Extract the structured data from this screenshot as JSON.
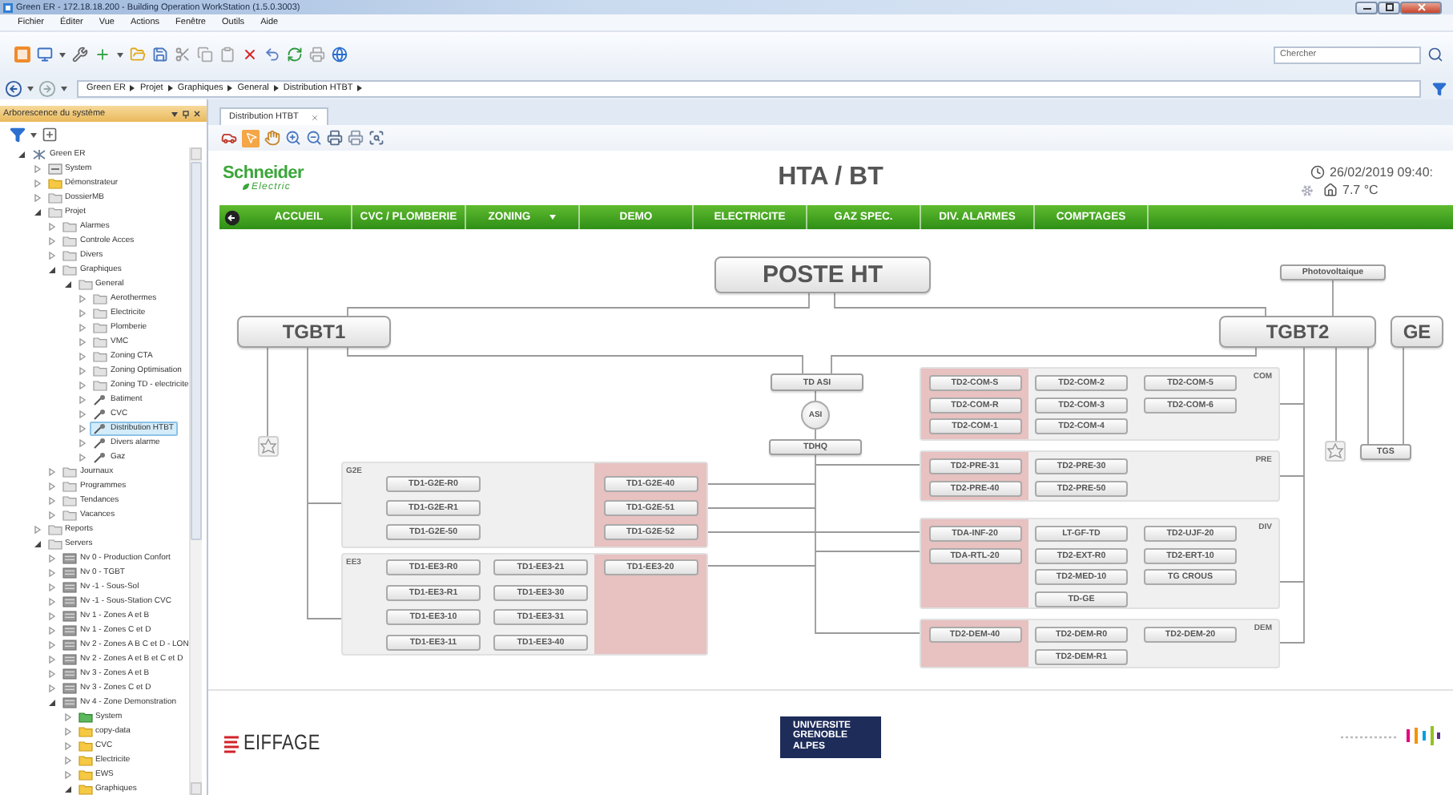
{
  "window": {
    "title": "Green ER - 172.18.18.200 - Building Operation WorkStation (1.5.0.3003)"
  },
  "menu": [
    "Fichier",
    "Éditer",
    "Vue",
    "Actions",
    "Fenêtre",
    "Outils",
    "Aide"
  ],
  "search": {
    "placeholder": "Chercher"
  },
  "breadcrumb": [
    "Green ER",
    "Projet",
    "Graphiques",
    "General",
    "Distribution HTBT"
  ],
  "tree_panel": {
    "title": "Arborescence du système",
    "items": [
      {
        "label": "Green ER",
        "kind": "network",
        "expanded": true,
        "selected": false,
        "children": [
          {
            "label": "System",
            "kind": "system",
            "expanded": false,
            "selected": false
          },
          {
            "label": "Démonstrateur",
            "kind": "folder_yellow",
            "expanded": false,
            "selected": false
          },
          {
            "label": "DossierMB",
            "kind": "folder",
            "expanded": false,
            "selected": false
          },
          {
            "label": "Projet",
            "kind": "folder",
            "expanded": true,
            "selected": false,
            "children": [
              {
                "label": "Alarmes",
                "kind": "folder",
                "expanded": false,
                "selected": false
              },
              {
                "label": "Controle Acces",
                "kind": "folder",
                "expanded": false,
                "selected": false
              },
              {
                "label": "Divers",
                "kind": "folder",
                "expanded": false,
                "selected": false
              },
              {
                "label": "Graphiques",
                "kind": "folder",
                "expanded": true,
                "selected": false,
                "children": [
                  {
                    "label": "General",
                    "kind": "folder",
                    "expanded": true,
                    "selected": false,
                    "children": [
                      {
                        "label": "Aerothermes",
                        "kind": "folder",
                        "expanded": false,
                        "selected": false
                      },
                      {
                        "label": "Electricite",
                        "kind": "folder",
                        "expanded": false,
                        "selected": false
                      },
                      {
                        "label": "Plomberie",
                        "kind": "folder",
                        "expanded": false,
                        "selected": false
                      },
                      {
                        "label": "VMC",
                        "kind": "folder",
                        "expanded": false,
                        "selected": false
                      },
                      {
                        "label": "Zoning CTA",
                        "kind": "folder",
                        "expanded": false,
                        "selected": false
                      },
                      {
                        "label": "Zoning Optimisation",
                        "kind": "folder",
                        "expanded": false,
                        "selected": false
                      },
                      {
                        "label": "Zoning TD - electricite",
                        "kind": "folder",
                        "expanded": false,
                        "selected": false
                      },
                      {
                        "label": "Batiment",
                        "kind": "graphic",
                        "expanded": false,
                        "selected": false
                      },
                      {
                        "label": "CVC",
                        "kind": "graphic",
                        "expanded": false,
                        "selected": false
                      },
                      {
                        "label": "Distribution HTBT",
                        "kind": "graphic",
                        "expanded": false,
                        "selected": true
                      },
                      {
                        "label": "Divers alarme",
                        "kind": "graphic",
                        "expanded": false,
                        "selected": false
                      },
                      {
                        "label": "Gaz",
                        "kind": "graphic",
                        "expanded": false,
                        "selected": false
                      }
                    ]
                  }
                ]
              },
              {
                "label": "Journaux",
                "kind": "folder",
                "expanded": false,
                "selected": false
              },
              {
                "label": "Programmes",
                "kind": "folder",
                "expanded": false,
                "selected": false
              },
              {
                "label": "Tendances",
                "kind": "folder",
                "expanded": false,
                "selected": false
              },
              {
                "label": "Vacances",
                "kind": "folder",
                "expanded": false,
                "selected": false
              }
            ]
          },
          {
            "label": "Reports",
            "kind": "folder",
            "expanded": false,
            "selected": false
          },
          {
            "label": "Servers",
            "kind": "folder",
            "expanded": true,
            "selected": false,
            "children": [
              {
                "label": "Nv 0 - Production Confort",
                "kind": "server",
                "expanded": false,
                "selected": false
              },
              {
                "label": "Nv 0 - TGBT",
                "kind": "server",
                "expanded": false,
                "selected": false
              },
              {
                "label": "Nv -1 - Sous-Sol",
                "kind": "server",
                "expanded": false,
                "selected": false
              },
              {
                "label": "Nv -1 - Sous-Station CVC",
                "kind": "server",
                "expanded": false,
                "selected": false
              },
              {
                "label": "Nv 1 - Zones A et B",
                "kind": "server",
                "expanded": false,
                "selected": false
              },
              {
                "label": "Nv 1 - Zones C et D",
                "kind": "server",
                "expanded": false,
                "selected": false
              },
              {
                "label": "Nv 2 - Zones A B C et D - LON",
                "kind": "server",
                "expanded": false,
                "selected": false
              },
              {
                "label": "Nv 2 - Zones A et B et C et D",
                "kind": "server",
                "expanded": false,
                "selected": false
              },
              {
                "label": "Nv 3 - Zones A et B",
                "kind": "server",
                "expanded": false,
                "selected": false
              },
              {
                "label": "Nv 3 - Zones C et D",
                "kind": "server",
                "expanded": false,
                "selected": false
              },
              {
                "label": "Nv 4 - Zone Demonstration",
                "kind": "server",
                "expanded": true,
                "selected": false,
                "children": [
                  {
                    "label": "System",
                    "kind": "folder_green",
                    "expanded": false,
                    "selected": false
                  },
                  {
                    "label": "copy-data",
                    "kind": "folder_yellow",
                    "expanded": false,
                    "selected": false
                  },
                  {
                    "label": "CVC",
                    "kind": "folder_yellow",
                    "expanded": false,
                    "selected": false
                  },
                  {
                    "label": "Electricite",
                    "kind": "folder_yellow",
                    "expanded": false,
                    "selected": false
                  },
                  {
                    "label": "EWS",
                    "kind": "folder_yellow",
                    "expanded": false,
                    "selected": false
                  },
                  {
                    "label": "Graphiques",
                    "kind": "folder_yellow",
                    "expanded": true,
                    "selected": false
                  }
                ]
              }
            ]
          }
        ]
      }
    ]
  },
  "document_tabs": [
    {
      "label": "Distribution HTBT",
      "selected": true
    }
  ],
  "graphic": {
    "brand": "Schneider",
    "brand_sub": "Electric",
    "title": "HTA / BT",
    "datetime": "26/02/2019 09:40:",
    "temperature": "7.7 °C",
    "nav": [
      {
        "label": "ACCUEIL",
        "dropdown": false
      },
      {
        "label": "CVC / PLOMBERIE",
        "dropdown": false
      },
      {
        "label": "ZONING",
        "dropdown": true
      },
      {
        "label": "DEMO",
        "dropdown": false
      },
      {
        "label": "ELECTRICITE",
        "dropdown": false
      },
      {
        "label": "GAZ SPEC.",
        "dropdown": false
      },
      {
        "label": "DIV. ALARMES",
        "dropdown": false
      },
      {
        "label": "COMPTAGES",
        "dropdown": false
      }
    ],
    "diagram": {
      "source": "POSTE HT",
      "photovoltaic": "Photovoltaique",
      "boards": [
        "TGBT1",
        "TGBT2"
      ],
      "generator": "GE",
      "ups_board": "TD ASI",
      "ups": "ASI",
      "hq_board": "TDHQ",
      "tgs": "TGS",
      "groups": [
        {
          "label": "G2E",
          "kind": "left",
          "alert": [
            "TD1-G2E-40",
            "TD1-G2E-51",
            "TD1-G2E-52"
          ],
          "columns": [
            [
              "TD1-G2E-R0",
              "TD1-G2E-R1",
              "TD1-G2E-50"
            ]
          ]
        },
        {
          "label": "EE3",
          "kind": "left",
          "alert": [
            "TD1-EE3-20"
          ],
          "columns": [
            [
              "TD1-EE3-R0",
              "TD1-EE3-R1",
              "TD1-EE3-10",
              "TD1-EE3-11"
            ],
            [
              "TD1-EE3-21",
              "TD1-EE3-30",
              "TD1-EE3-31",
              "TD1-EE3-40"
            ]
          ]
        },
        {
          "label": "COM",
          "kind": "right",
          "alert": [
            "TD2-COM-S",
            "TD2-COM-R",
            "TD2-COM-1"
          ],
          "columns": [
            [
              "TD2-COM-2",
              "TD2-COM-3",
              "TD2-COM-4"
            ],
            [
              "TD2-COM-5",
              "TD2-COM-6"
            ]
          ]
        },
        {
          "label": "PRE",
          "kind": "right",
          "alert": [
            "TD2-PRE-31",
            "TD2-PRE-40"
          ],
          "columns": [
            [
              "TD2-PRE-30",
              "TD2-PRE-50"
            ]
          ]
        },
        {
          "label": "DIV",
          "kind": "right",
          "alert": [
            "TDA-INF-20",
            "TDA-RTL-20"
          ],
          "columns": [
            [
              "LT-GF-TD",
              "TD2-EXT-R0",
              "TD2-MED-10",
              "TD-GE"
            ],
            [
              "TD2-UJF-20",
              "TD2-ERT-10",
              "TG CROUS"
            ]
          ]
        },
        {
          "label": "DEM",
          "kind": "right",
          "alert": [
            "TD2-DEM-40"
          ],
          "columns": [
            [
              "TD2-DEM-R0",
              "TD2-DEM-R1"
            ],
            [
              "TD2-DEM-20"
            ]
          ]
        }
      ]
    },
    "footer": {
      "company": "EIFFAGE",
      "university": [
        "UNIVERSITE",
        "GRENOBLE",
        "ALPES"
      ]
    }
  }
}
